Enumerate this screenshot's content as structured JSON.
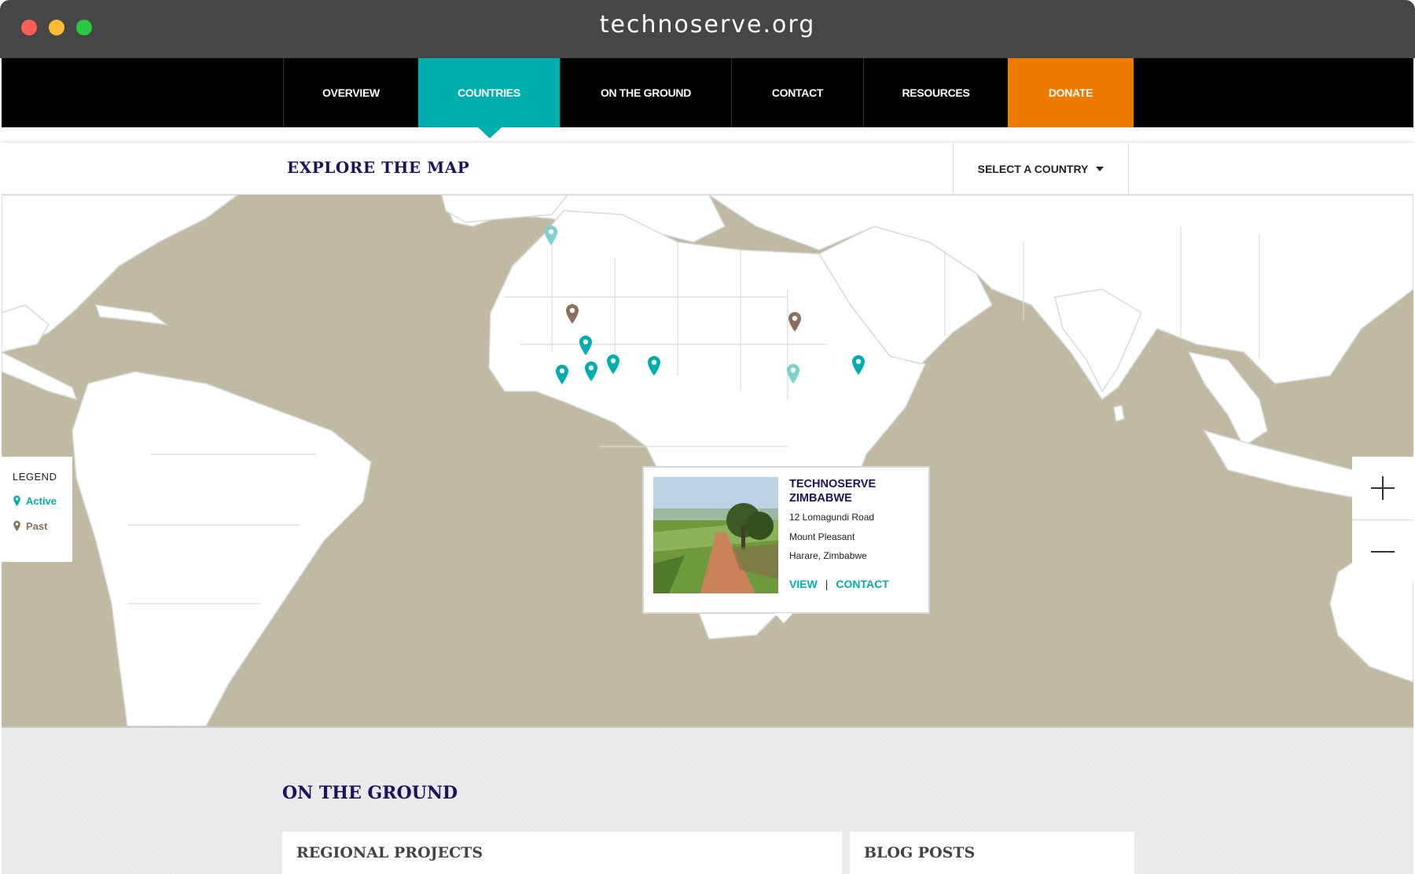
{
  "window": {
    "title": "technoserve.org"
  },
  "nav": {
    "items": [
      {
        "label": "OVERVIEW"
      },
      {
        "label": "COUNTRIES"
      },
      {
        "label": "ON THE GROUND"
      },
      {
        "label": "CONTACT"
      },
      {
        "label": "RESOURCES"
      },
      {
        "label": "DONATE"
      }
    ],
    "active": "COUNTRIES"
  },
  "explore": {
    "title": "EXPLORE THE MAP",
    "select_label": "SELECT A COUNTRY"
  },
  "legend": {
    "title": "LEGEND",
    "active_label": "Active",
    "past_label": "Past"
  },
  "colors": {
    "active": "#00aeae",
    "active_light": "#7fd0d0",
    "past": "#8a6f5e",
    "donate": "#ef7a00",
    "heading": "#201160",
    "ocean": "#bfbaa1"
  },
  "popup": {
    "title_line1": "TECHNOSERVE",
    "title_line2": "ZIMBABWE",
    "address_line1": "12 Lomagundi Road",
    "address_line2": "Mount Pleasant",
    "address_line3": "Harare, Zimbabwe",
    "view_label": "VIEW",
    "separator": "|",
    "contact_label": "CONTACT"
  },
  "ground": {
    "title": "ON THE GROUND",
    "cards": [
      {
        "title": "REGIONAL PROJECTS"
      },
      {
        "title": "BLOG POSTS"
      }
    ]
  }
}
